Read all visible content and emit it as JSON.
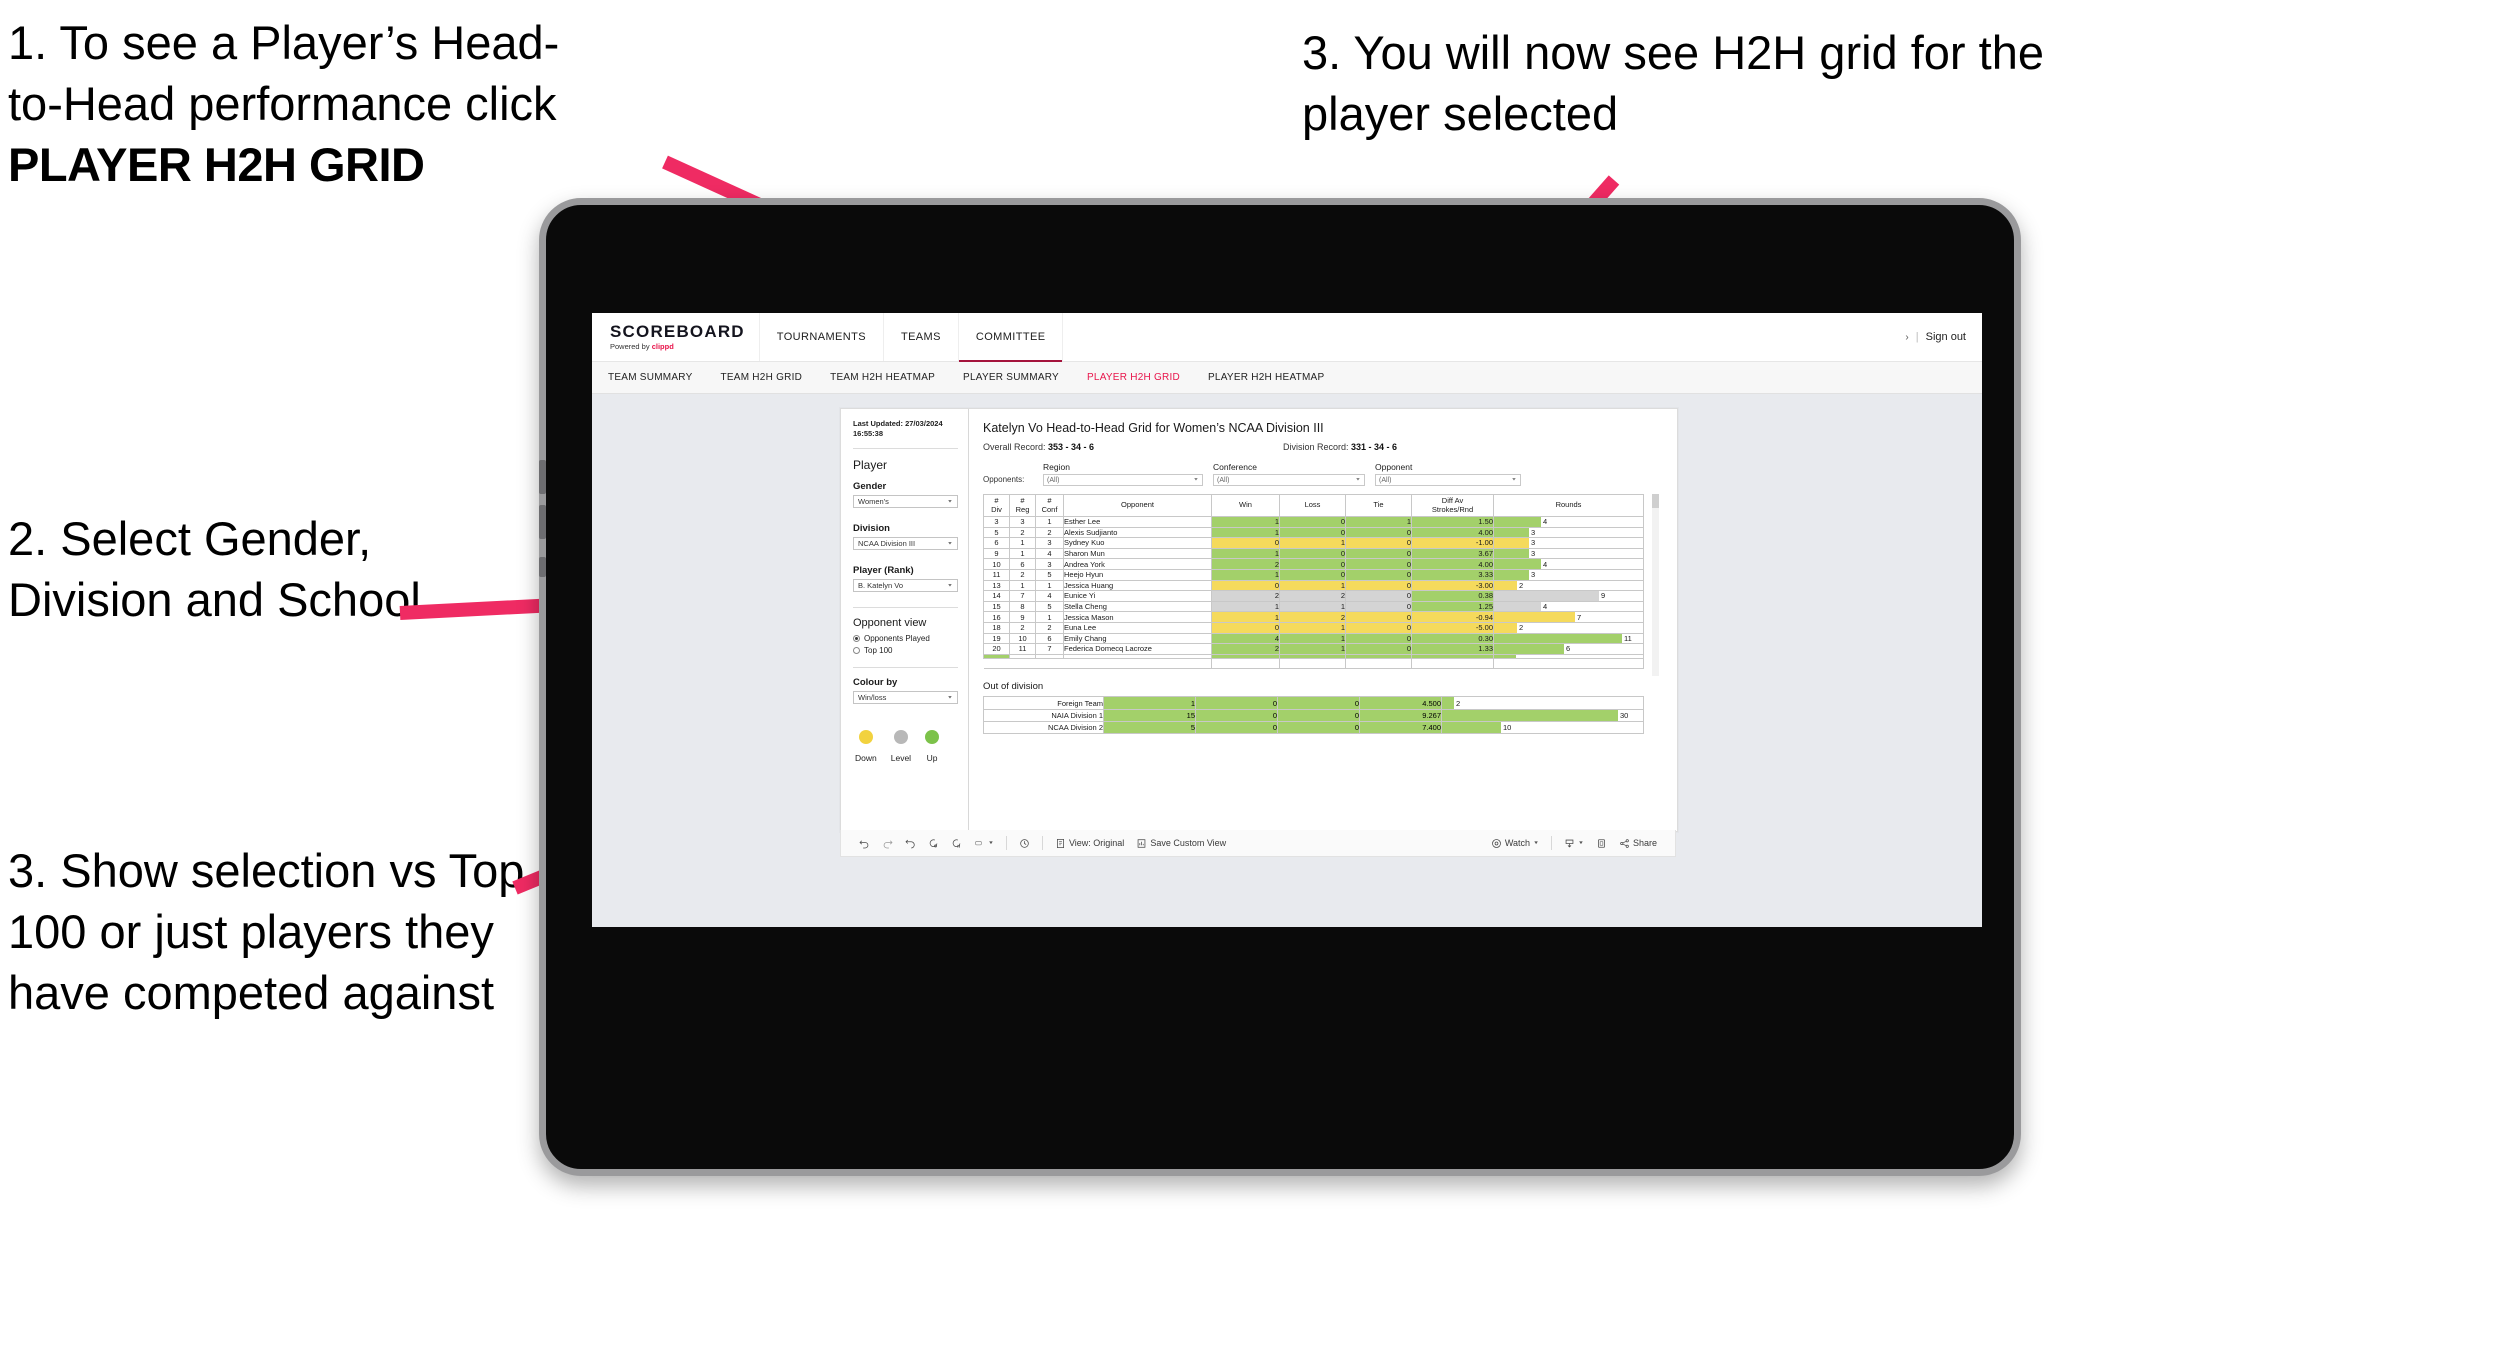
{
  "annotations": {
    "a1_line1": "1. To see a Player’s Head-",
    "a1_line2": "to-Head performance click",
    "a1_strong": "PLAYER H2H GRID",
    "a2": "2. Select Gender, Division and School",
    "a3": "3. Show selection vs Top 100 or just players they have competed against",
    "a4": "3. You will now see H2H grid for the player selected",
    "arrow_color": "#ef2b63"
  },
  "app": {
    "brand": {
      "title": "SCOREBOARD",
      "powered_prefix": "Powered by ",
      "powered_brand": "clippd"
    },
    "nav": [
      {
        "label": "TOURNAMENTS"
      },
      {
        "label": "TEAMS"
      },
      {
        "label": "COMMITTEE"
      }
    ],
    "header_right": {
      "chevron": "›",
      "separator": "|",
      "sign_out": "Sign out"
    },
    "subnav": [
      {
        "label": "TEAM SUMMARY",
        "active": false
      },
      {
        "label": "TEAM H2H GRID",
        "active": false
      },
      {
        "label": "TEAM H2H HEATMAP",
        "active": false
      },
      {
        "label": "PLAYER SUMMARY",
        "active": false
      },
      {
        "label": "PLAYER H2H GRID",
        "active": true
      },
      {
        "label": "PLAYER H2H HEATMAP",
        "active": false
      }
    ],
    "accent": "#e8154b"
  },
  "sidepanel": {
    "last_updated_line1": "Last Updated: 27/03/2024",
    "last_updated_line2": "16:55:38",
    "player_heading": "Player",
    "gender_label": "Gender",
    "gender_value": "Women's",
    "division_label": "Division",
    "division_value": "NCAA Division III",
    "player_rank_label": "Player (Rank)",
    "player_rank_value": "B. Katelyn Vo",
    "opponent_view_heading": "Opponent view",
    "opponent_options": [
      {
        "label": "Opponents Played",
        "selected": true
      },
      {
        "label": "Top 100",
        "selected": false
      }
    ],
    "colour_by_label": "Colour by",
    "colour_by_value": "Win/loss",
    "legend": [
      {
        "label": "Down",
        "color": "#f2d23f"
      },
      {
        "label": "Level",
        "color": "#b8b8b8"
      },
      {
        "label": "Up",
        "color": "#7cc24a"
      }
    ]
  },
  "main": {
    "title": "Katelyn Vo Head-to-Head Grid for Women’s NCAA Division III",
    "overall_record_label": "Overall Record: ",
    "overall_record_value": "353 - 34 - 6",
    "division_record_label": "Division Record: ",
    "division_record_value": "331 - 34 - 6",
    "opponents_label": "Opponents:",
    "filters": [
      {
        "caption": "Region",
        "value": "(All)"
      },
      {
        "caption": "Conference",
        "value": "(All)"
      },
      {
        "caption": "Opponent",
        "value": "(All)"
      }
    ],
    "columns": [
      "# Div",
      "# Reg",
      "# Conf",
      "Opponent",
      "Win",
      "Loss",
      "Tie",
      "Diff Av Strokes/Rnd",
      "Rounds"
    ],
    "columns_split": [
      {
        "l1": "#",
        "l2": "Div"
      },
      {
        "l1": "#",
        "l2": "Reg"
      },
      {
        "l1": "#",
        "l2": "Conf"
      },
      {
        "l1": "Opponent",
        "l2": ""
      },
      {
        "l1": "Win",
        "l2": ""
      },
      {
        "l1": "Loss",
        "l2": ""
      },
      {
        "l1": "Tie",
        "l2": ""
      },
      {
        "l1": "Diff Av",
        "l2": "Strokes/Rnd"
      },
      {
        "l1": "Rounds",
        "l2": ""
      }
    ],
    "rows": [
      {
        "div": "3",
        "reg": "3",
        "conf": "1",
        "opponent": "Esther Lee",
        "win": "1",
        "loss": "0",
        "tie": "1",
        "diff": "1.50",
        "rounds": "4",
        "state": "up"
      },
      {
        "div": "5",
        "reg": "2",
        "conf": "2",
        "opponent": "Alexis Sudjianto",
        "win": "1",
        "loss": "0",
        "tie": "0",
        "diff": "4.00",
        "rounds": "3",
        "state": "up"
      },
      {
        "div": "6",
        "reg": "1",
        "conf": "3",
        "opponent": "Sydney Kuo",
        "win": "0",
        "loss": "1",
        "tie": "0",
        "diff": "-1.00",
        "rounds": "3",
        "state": "down"
      },
      {
        "div": "9",
        "reg": "1",
        "conf": "4",
        "opponent": "Sharon Mun",
        "win": "1",
        "loss": "0",
        "tie": "0",
        "diff": "3.67",
        "rounds": "3",
        "state": "up"
      },
      {
        "div": "10",
        "reg": "6",
        "conf": "3",
        "opponent": "Andrea York",
        "win": "2",
        "loss": "0",
        "tie": "0",
        "diff": "4.00",
        "rounds": "4",
        "state": "up"
      },
      {
        "div": "11",
        "reg": "2",
        "conf": "5",
        "opponent": "Heejo Hyun",
        "win": "1",
        "loss": "0",
        "tie": "0",
        "diff": "3.33",
        "rounds": "3",
        "state": "up"
      },
      {
        "div": "13",
        "reg": "1",
        "conf": "1",
        "opponent": "Jessica Huang",
        "win": "0",
        "loss": "1",
        "tie": "0",
        "diff": "-3.00",
        "rounds": "2",
        "state": "down"
      },
      {
        "div": "14",
        "reg": "7",
        "conf": "4",
        "opponent": "Eunice Yi",
        "win": "2",
        "loss": "2",
        "tie": "0",
        "diff": "0.38",
        "rounds": "9",
        "state": "level"
      },
      {
        "div": "15",
        "reg": "8",
        "conf": "5",
        "opponent": "Stella Cheng",
        "win": "1",
        "loss": "1",
        "tie": "0",
        "diff": "1.25",
        "rounds": "4",
        "state": "level"
      },
      {
        "div": "16",
        "reg": "9",
        "conf": "1",
        "opponent": "Jessica Mason",
        "win": "1",
        "loss": "2",
        "tie": "0",
        "diff": "-0.94",
        "rounds": "7",
        "state": "down"
      },
      {
        "div": "18",
        "reg": "2",
        "conf": "2",
        "opponent": "Euna Lee",
        "win": "0",
        "loss": "1",
        "tie": "0",
        "diff": "-5.00",
        "rounds": "2",
        "state": "down"
      },
      {
        "div": "19",
        "reg": "10",
        "conf": "6",
        "opponent": "Emily Chang",
        "win": "4",
        "loss": "1",
        "tie": "0",
        "diff": "0.30",
        "rounds": "11",
        "state": "up"
      },
      {
        "div": "20",
        "reg": "11",
        "conf": "7",
        "opponent": "Federica Domecq Lacroze",
        "win": "2",
        "loss": "1",
        "tie": "0",
        "diff": "1.33",
        "rounds": "6",
        "state": "up"
      }
    ],
    "out_of_division_title": "Out of division",
    "out_of_division_rows": [
      {
        "name": "Foreign Team",
        "win": "1",
        "loss": "0",
        "tie": "0",
        "diff": "4.500",
        "rounds": "2",
        "state": "up"
      },
      {
        "name": "NAIA Division 1",
        "win": "15",
        "loss": "0",
        "tie": "0",
        "diff": "9.267",
        "rounds": "30",
        "state": "up"
      },
      {
        "name": "NCAA Division 2",
        "win": "5",
        "loss": "0",
        "tie": "0",
        "diff": "7.400",
        "rounds": "10",
        "state": "up"
      }
    ],
    "colors": {
      "up": "#a3d06a",
      "down": "#f5da5c",
      "level": "#d4d4d4"
    }
  },
  "toolbar": {
    "items": [
      {
        "name": "undo-icon",
        "label": ""
      },
      {
        "name": "redo-icon",
        "label": ""
      },
      {
        "name": "revert-icon",
        "label": ""
      },
      {
        "name": "refresh-data-icon",
        "label": ""
      },
      {
        "name": "pause-updates-icon",
        "label": ""
      },
      {
        "name": "highlight-icon",
        "label": "",
        "caret": "▾"
      },
      {
        "name": "history-icon",
        "label": ""
      },
      {
        "name": "view-original",
        "label": "View: Original"
      },
      {
        "name": "save-custom-view",
        "label": "Save Custom View"
      },
      {
        "name": "watch",
        "label": "Watch",
        "caret": "▾"
      },
      {
        "name": "download",
        "label": "",
        "caret": "▾"
      },
      {
        "name": "fullscreen",
        "label": ""
      },
      {
        "name": "share",
        "label": "Share"
      }
    ],
    "view_original": "View: Original",
    "save_custom_view": "Save Custom View",
    "watch": "Watch",
    "share": "Share"
  },
  "chart_data": {
    "type": "table",
    "title": "Katelyn Vo Head-to-Head Grid for Women’s NCAA Division III",
    "columns": [
      "# Div",
      "# Reg",
      "# Conf",
      "Opponent",
      "Win",
      "Loss",
      "Tie",
      "Diff Av Strokes/Rnd",
      "Rounds"
    ],
    "rows": [
      [
        "3",
        "3",
        "1",
        "Esther Lee",
        "1",
        "0",
        "1",
        "1.50",
        "4"
      ],
      [
        "5",
        "2",
        "2",
        "Alexis Sudjianto",
        "1",
        "0",
        "0",
        "4.00",
        "3"
      ],
      [
        "6",
        "1",
        "3",
        "Sydney Kuo",
        "0",
        "1",
        "0",
        "-1.00",
        "3"
      ],
      [
        "9",
        "1",
        "4",
        "Sharon Mun",
        "1",
        "0",
        "0",
        "3.67",
        "3"
      ],
      [
        "10",
        "6",
        "3",
        "Andrea York",
        "2",
        "0",
        "0",
        "4.00",
        "4"
      ],
      [
        "11",
        "2",
        "5",
        "Heejo Hyun",
        "1",
        "0",
        "0",
        "3.33",
        "3"
      ],
      [
        "13",
        "1",
        "1",
        "Jessica Huang",
        "0",
        "1",
        "0",
        "-3.00",
        "2"
      ],
      [
        "14",
        "7",
        "4",
        "Eunice Yi",
        "2",
        "2",
        "0",
        "0.38",
        "9"
      ],
      [
        "15",
        "8",
        "5",
        "Stella Cheng",
        "1",
        "1",
        "0",
        "1.25",
        "4"
      ],
      [
        "16",
        "9",
        "1",
        "Jessica Mason",
        "1",
        "2",
        "0",
        "-0.94",
        "7"
      ],
      [
        "18",
        "2",
        "2",
        "Euna Lee",
        "0",
        "1",
        "0",
        "-5.00",
        "2"
      ],
      [
        "19",
        "10",
        "6",
        "Emily Chang",
        "4",
        "1",
        "0",
        "0.30",
        "11"
      ],
      [
        "20",
        "11",
        "7",
        "Federica Domecq Lacroze",
        "2",
        "1",
        "0",
        "1.33",
        "6"
      ]
    ],
    "out_of_division": [
      [
        "Foreign Team",
        "1",
        "0",
        "0",
        "4.500",
        "2"
      ],
      [
        "NAIA Division 1",
        "15",
        "0",
        "0",
        "9.267",
        "30"
      ],
      [
        "NCAA Division 2",
        "5",
        "0",
        "0",
        "7.400",
        "10"
      ]
    ],
    "legend": [
      {
        "label": "Down",
        "color": "#f2d23f"
      },
      {
        "label": "Level",
        "color": "#b8b8b8"
      },
      {
        "label": "Up",
        "color": "#7cc24a"
      }
    ]
  }
}
